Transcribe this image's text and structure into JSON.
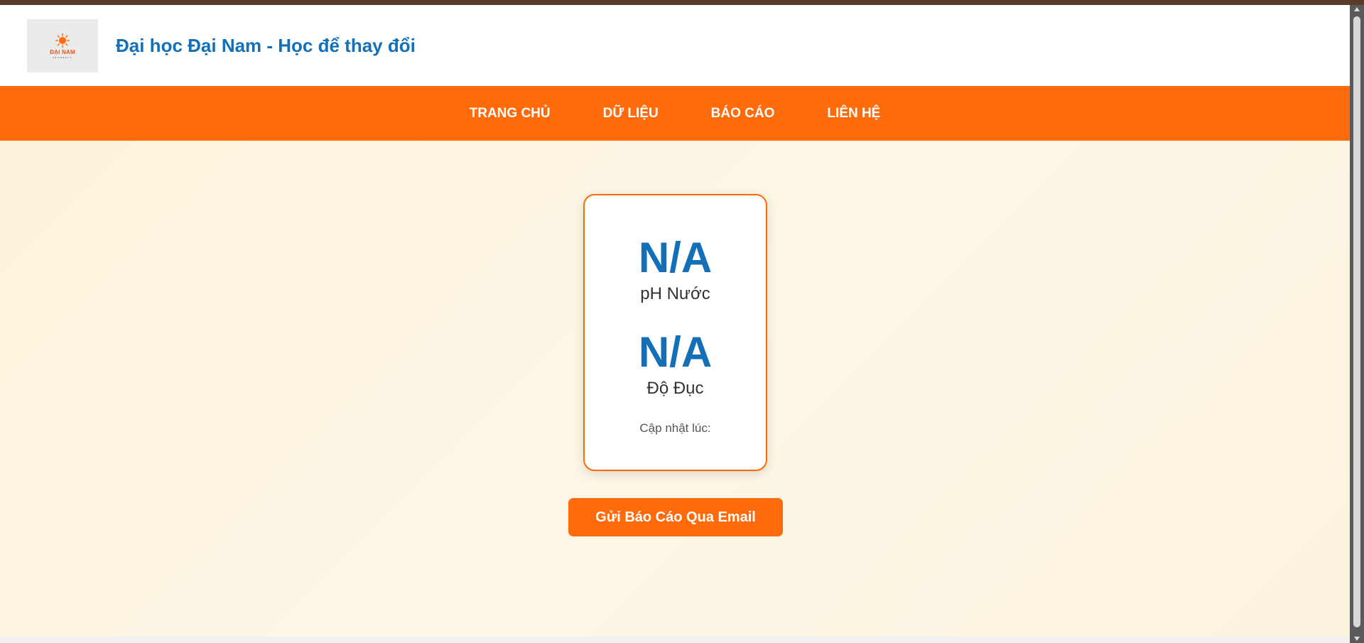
{
  "header": {
    "logo_text": "ĐẠI NAM",
    "logo_sub": "UNIVERSITY",
    "title": "Đại học Đại Nam - Học để thay đổi"
  },
  "nav": {
    "items": [
      {
        "label": "TRANG CHỦ"
      },
      {
        "label": "DỮ LIỆU"
      },
      {
        "label": "BÁO CÁO"
      },
      {
        "label": "LIÊN HỆ"
      }
    ]
  },
  "sensor_card": {
    "ph_value": "N/A",
    "ph_label": "pH Nước",
    "turbidity_value": "N/A",
    "turbidity_label": "Độ Đục",
    "updated_label": "Cập nhật lúc:"
  },
  "actions": {
    "email_button": "Gửi Báo Cáo Qua Email"
  },
  "colors": {
    "accent_orange": "#ff6b0a",
    "title_blue": "#1370b8",
    "background_cream": "#fdf3dc"
  },
  "icons": {
    "logo": "sun-logo-icon"
  }
}
